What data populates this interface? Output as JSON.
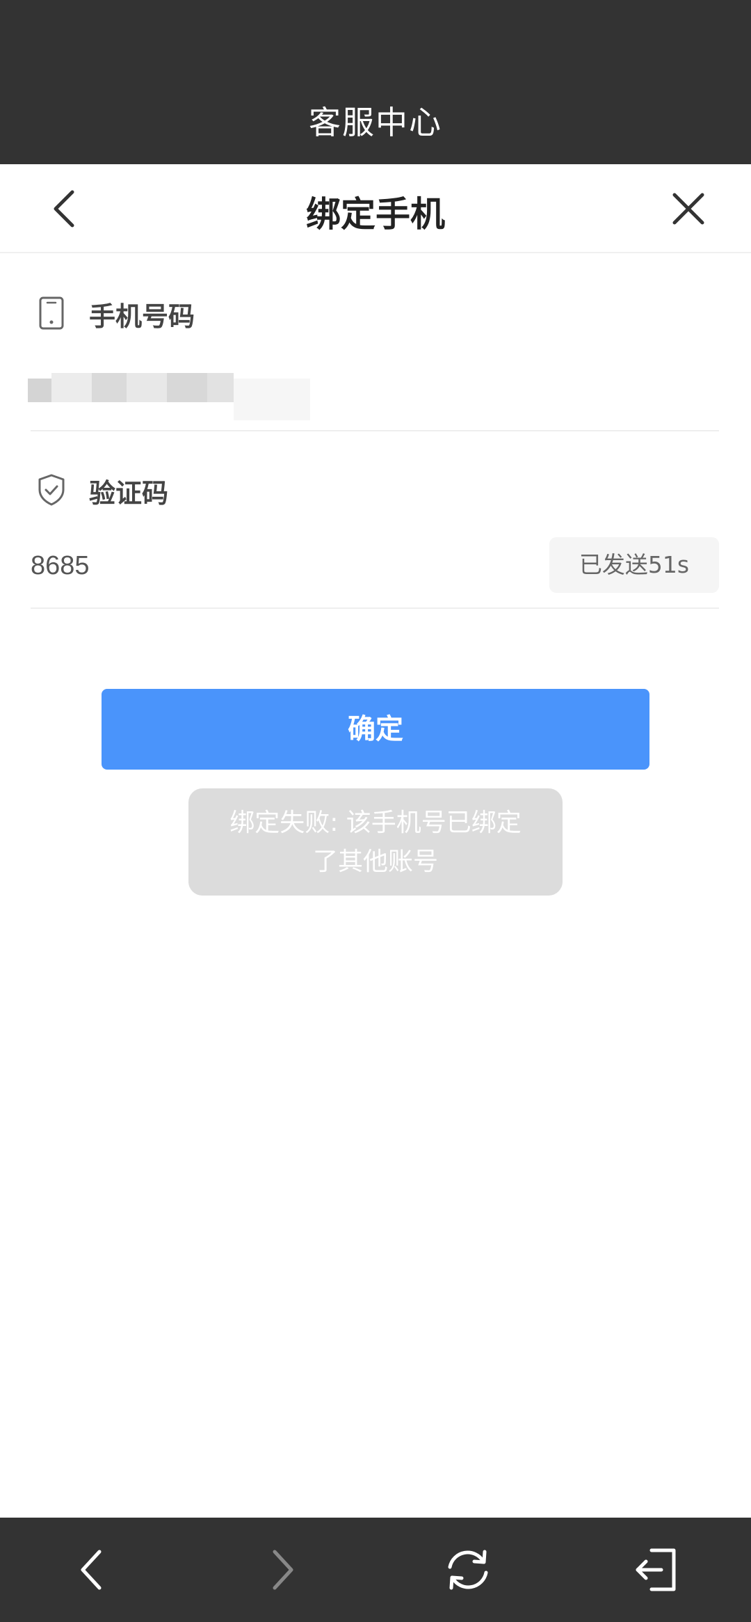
{
  "status_bar": {
    "title": "客服中心"
  },
  "nav": {
    "title": "绑定手机",
    "back_icon": "chevron-left-icon",
    "close_icon": "close-icon"
  },
  "phone_section": {
    "label": "手机号码",
    "icon": "phone-icon",
    "value_state": "redacted"
  },
  "code_section": {
    "label": "验证码",
    "icon": "shield-check-icon",
    "value": "8685",
    "resend_label": "已发送51s"
  },
  "confirm_label": "确定",
  "toast": {
    "line1": "绑定失败: 该手机号已绑定",
    "line2": "了其他账号"
  },
  "bottom_bar": {
    "back_icon": "chevron-left-icon",
    "forward_icon": "chevron-right-icon",
    "refresh_icon": "refresh-icon",
    "exit_icon": "exit-icon"
  },
  "colors": {
    "bar_bg": "#333333",
    "accent": "#4a94fb",
    "toast_bg": "#dcdcdc"
  }
}
